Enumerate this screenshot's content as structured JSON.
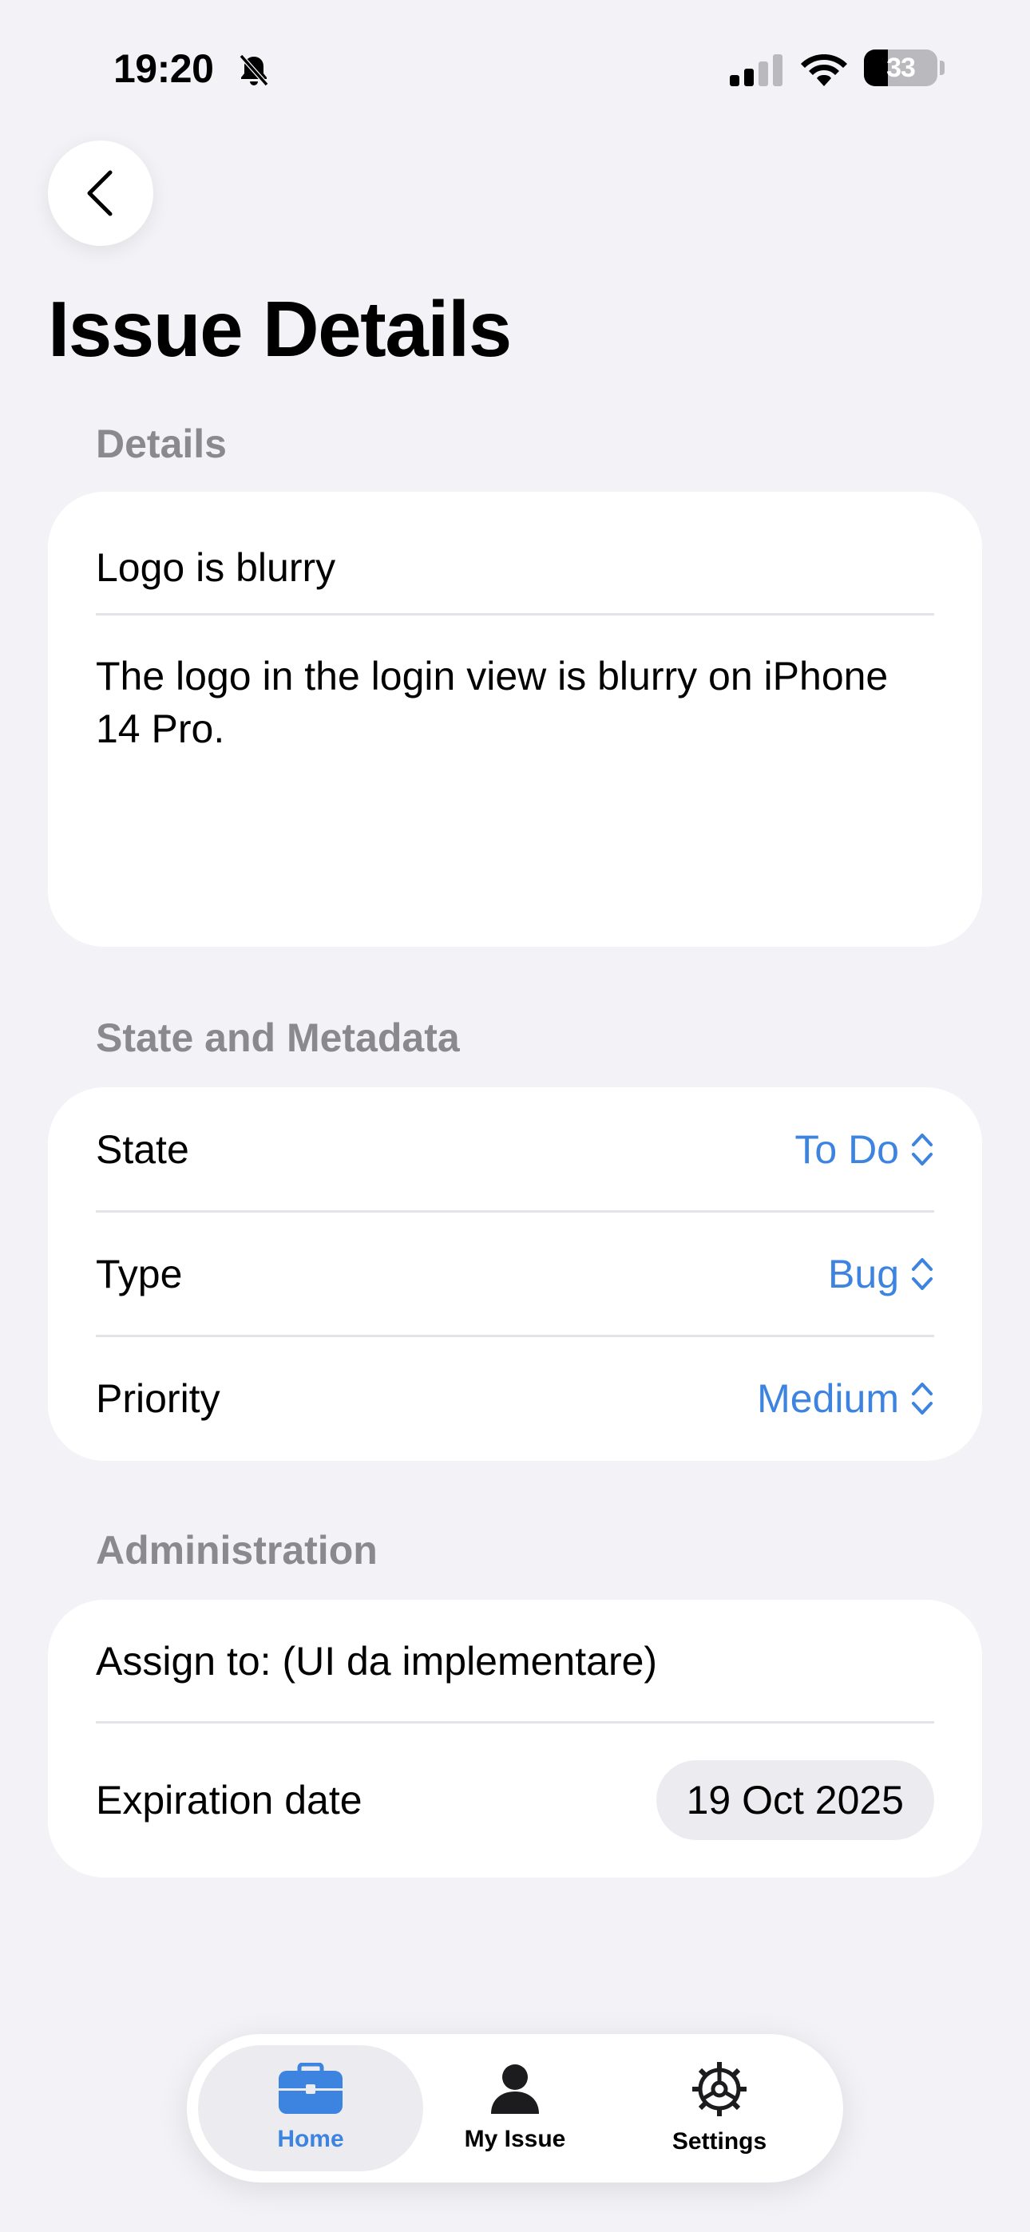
{
  "status_bar": {
    "time": "19:20",
    "battery_percent": "33",
    "battery_level": 0.33
  },
  "nav": {
    "back_icon": "chevron-left-icon",
    "title": "Issue Details"
  },
  "details": {
    "header": "Details",
    "title_value": "Logo is blurry",
    "description_value": "The logo in the login view is blurry on iPhone 14 Pro."
  },
  "state_metadata": {
    "header": "State and Metadata",
    "rows": [
      {
        "label": "State",
        "value": "To Do"
      },
      {
        "label": "Type",
        "value": "Bug"
      },
      {
        "label": "Priority",
        "value": "Medium"
      }
    ]
  },
  "administration": {
    "header": "Administration",
    "assign_label": "Assign to: (UI da implementare)",
    "expiration_label": "Expiration date",
    "expiration_value": "19 Oct 2025"
  },
  "tabbar": {
    "tabs": [
      {
        "label": "Home",
        "icon": "briefcase-icon",
        "active": true
      },
      {
        "label": "My Issue",
        "icon": "person-icon",
        "active": false
      },
      {
        "label": "Settings",
        "icon": "gear-icon",
        "active": false
      }
    ]
  },
  "colors": {
    "accent": "#3d83e0",
    "background": "#f2f2f7",
    "secondary_text": "#8a8a8e"
  }
}
